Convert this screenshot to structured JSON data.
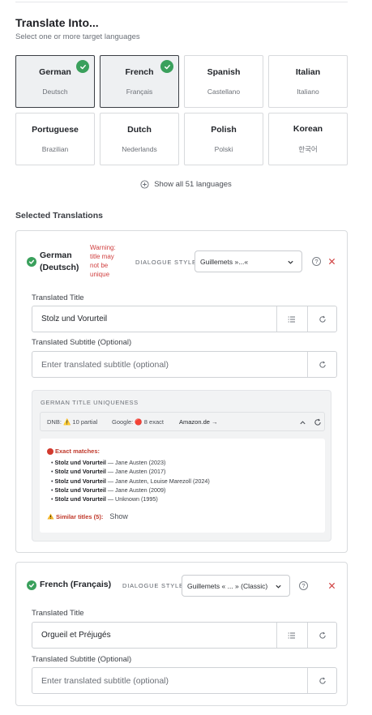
{
  "header": {
    "title": "Translate Into...",
    "subtitle": "Select one or more target languages"
  },
  "languages": [
    {
      "name": "German",
      "native": "Deutsch",
      "selected": true
    },
    {
      "name": "French",
      "native": "Français",
      "selected": true
    },
    {
      "name": "Spanish",
      "native": "Castellano",
      "selected": false
    },
    {
      "name": "Italian",
      "native": "Italiano",
      "selected": false
    },
    {
      "name": "Portuguese",
      "native": "Brazilian",
      "selected": false
    },
    {
      "name": "Dutch",
      "native": "Nederlands",
      "selected": false
    },
    {
      "name": "Polish",
      "native": "Polski",
      "selected": false
    },
    {
      "name": "Korean",
      "native": "한국어",
      "selected": false
    }
  ],
  "show_all_label": "Show all 51 languages",
  "selected_title": "Selected Translations",
  "german": {
    "heading": "German (Deutsch)",
    "warning": "Warning: title may not be unique",
    "dialogue_label": "DIALOGUE STYLE",
    "dialogue_value": "Guillemets »...«",
    "title_label": "Translated Title",
    "title_value": "Stolz und Vorurteil",
    "subtitle_label": "Translated Subtitle (Optional)",
    "subtitle_placeholder": "Enter translated subtitle (optional)",
    "uniqueness": {
      "title": "GERMAN TITLE UNIQUENESS",
      "dnb": "DNB: ⚠️ 10 partial",
      "google": "Google: 🔴 8 exact",
      "amazon": "Amazon.de →",
      "exact_label": "Exact matches:",
      "matches": [
        {
          "title": "Stolz und Vorurteil",
          "detail": " — Jane Austen (2023)"
        },
        {
          "title": "Stolz und Vorurteil",
          "detail": " — Jane Austen (2017)"
        },
        {
          "title": "Stolz und Vorurteil",
          "detail": " — Jane Austen, Louise Marezoll (2024)"
        },
        {
          "title": "Stolz und Vorurteil",
          "detail": " — Jane Austen (2009)"
        },
        {
          "title": "Stolz und Vorurteil",
          "detail": " — Unknown (1995)"
        }
      ],
      "similar_label": "Similar titles (5):",
      "similar_show": "Show"
    }
  },
  "french": {
    "heading": "French (Français)",
    "dialogue_label": "DIALOGUE STYLE",
    "dialogue_value": "Guillemets « ... » (Classic)",
    "title_label": "Translated Title",
    "title_value": "Orgueil et Préjugés",
    "subtitle_label": "Translated Subtitle (Optional)",
    "subtitle_placeholder": "Enter translated subtitle (optional)"
  },
  "colors": {
    "accent_green": "#3aa05c",
    "warning_red": "#d04040",
    "selected_border": "#3b3f45"
  }
}
